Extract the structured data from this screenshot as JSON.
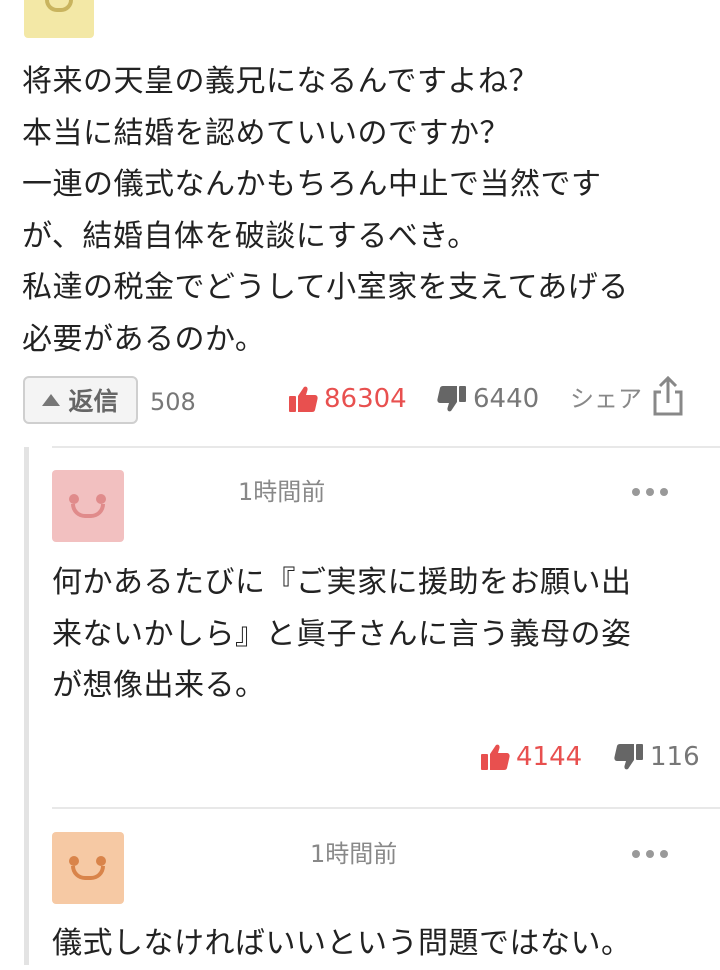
{
  "top_comment": {
    "lines": [
      "将来の天皇の義兄になるんですよね？",
      "本当に結婚を認めていいのですか？",
      "一連の儀式なんかもちろん中止で当然です",
      "が、結婚自体を破談にするべき。",
      "私達の税金でどうして小室家を支えてあげる",
      "必要があるのか。"
    ],
    "reply_label": "返信",
    "reply_count": "508",
    "likes": "86304",
    "dislikes": "6440",
    "share_label": "シェア"
  },
  "replies": [
    {
      "username": "",
      "time": "1時間前",
      "avatar_color": "#f2c0c0",
      "avatar_feature_color": "#e08b8b",
      "lines": [
        "何かあるたびに『ご実家に援助をお願い出",
        "来ないかしら』と眞子さんに言う義母の姿",
        "が想像出来る。"
      ],
      "likes": "4144",
      "dislikes": "116"
    },
    {
      "username": "",
      "time": "1時間前",
      "avatar_color": "#f6c9a4",
      "avatar_feature_color": "#d9844a",
      "lines": [
        "儀式しなければいいという問題ではない。"
      ]
    }
  ],
  "colors": {
    "like": "#e8504f",
    "neutral": "#777777",
    "top_avatar": "#f3e8a6"
  },
  "icons": [
    "thumbs-up-icon",
    "thumbs-down-icon",
    "share-icon",
    "more-icon",
    "caret-up-icon"
  ]
}
